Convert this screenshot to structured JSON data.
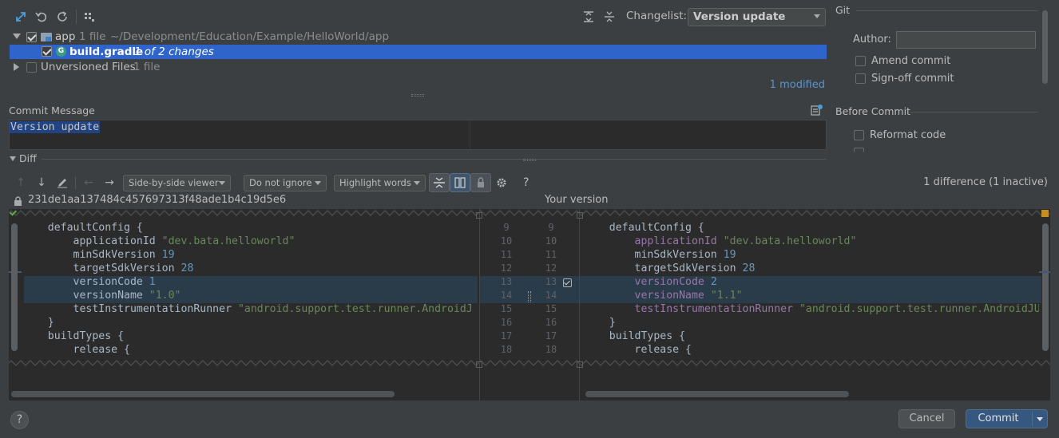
{
  "toolbar": {
    "changelist_label": "Changelist:",
    "changelist_value": "Version update"
  },
  "tree": {
    "root": {
      "name": "app",
      "count": "1 file",
      "path": "~/Development/Education/Example/HelloWorld/app"
    },
    "file": {
      "name": "build.gradle",
      "status": "1 of 2 changes"
    },
    "unversioned": {
      "name": "Unversioned Files",
      "count": "1 file"
    },
    "modified": "1 modified"
  },
  "commit": {
    "label": "Commit Message",
    "message": "Version update"
  },
  "git": {
    "section": "Git",
    "author_label": "Author:",
    "author_value": "",
    "amend": "Amend commit",
    "signoff": "Sign-off commit",
    "before_commit": "Before Commit",
    "reformat": "Reformat code"
  },
  "diff": {
    "label": "Diff",
    "viewer": "Side-by-side viewer",
    "ignore": "Do not ignore",
    "highlight": "Highlight words",
    "help": "?",
    "summary": "1 difference (1 inactive)",
    "left_title": "231de1aa137484c457697313f48ade1b4c19d5e6",
    "right_title": "Your version",
    "line_numbers": [
      "9",
      "10",
      "11",
      "12",
      "13",
      "14",
      "15",
      "16",
      "17",
      "18"
    ],
    "left_lines": [
      [
        {
          "t": "    defaultConfig {",
          "c": "plain"
        }
      ],
      [
        {
          "t": "        applicationId ",
          "c": "plain"
        },
        {
          "t": "\"dev.bata.helloworld\"",
          "c": "kw-str"
        }
      ],
      [
        {
          "t": "        minSdkVersion ",
          "c": "plain"
        },
        {
          "t": "19",
          "c": "kw-num"
        }
      ],
      [
        {
          "t": "        targetSdkVersion ",
          "c": "plain"
        },
        {
          "t": "28",
          "c": "kw-num"
        }
      ],
      [
        {
          "t": "        versionCode ",
          "c": "plain"
        },
        {
          "t": "1",
          "c": "kw-num"
        }
      ],
      [
        {
          "t": "        versionName ",
          "c": "plain"
        },
        {
          "t": "\"1.0\"",
          "c": "kw-str"
        }
      ],
      [
        {
          "t": "        testInstrumentationRunner ",
          "c": "plain"
        },
        {
          "t": "\"android.support.test.runner.AndroidJ",
          "c": "kw-str"
        }
      ],
      [
        {
          "t": "    }",
          "c": "plain"
        }
      ],
      [
        {
          "t": "    buildTypes {",
          "c": "plain"
        }
      ],
      [
        {
          "t": "        release {",
          "c": "plain"
        }
      ]
    ],
    "right_lines": [
      [
        {
          "t": "    defaultConfig {",
          "c": "plain"
        }
      ],
      [
        {
          "t": "        ",
          "c": "plain"
        },
        {
          "t": "applicationId",
          "c": "kw-purple"
        },
        {
          "t": " ",
          "c": "plain"
        },
        {
          "t": "\"dev.bata.helloworld\"",
          "c": "kw-str"
        }
      ],
      [
        {
          "t": "        minSdkVersion ",
          "c": "plain"
        },
        {
          "t": "19",
          "c": "kw-num"
        }
      ],
      [
        {
          "t": "        targetSdkVersion ",
          "c": "plain"
        },
        {
          "t": "28",
          "c": "kw-num"
        }
      ],
      [
        {
          "t": "        ",
          "c": "plain"
        },
        {
          "t": "versionCode",
          "c": "kw-purple"
        },
        {
          "t": " ",
          "c": "plain"
        },
        {
          "t": "2",
          "c": "kw-num"
        }
      ],
      [
        {
          "t": "        ",
          "c": "plain"
        },
        {
          "t": "versionName",
          "c": "kw-purple"
        },
        {
          "t": " ",
          "c": "plain"
        },
        {
          "t": "\"1.1\"",
          "c": "kw-str"
        }
      ],
      [
        {
          "t": "        ",
          "c": "plain"
        },
        {
          "t": "testInstrumentationRunner",
          "c": "kw-purple"
        },
        {
          "t": " ",
          "c": "plain"
        },
        {
          "t": "\"android.support.test.runner.AndroidJUn",
          "c": "kw-str"
        }
      ],
      [
        {
          "t": "    }",
          "c": "plain"
        }
      ],
      [
        {
          "t": "    buildTypes {",
          "c": "plain"
        }
      ],
      [
        {
          "t": "        release {",
          "c": "plain"
        }
      ]
    ]
  },
  "footer": {
    "help": "?",
    "cancel": "Cancel",
    "commit": "Commit"
  },
  "colors": {
    "selection": "#2f65ca",
    "changed_line": "#2a3b4a",
    "background": "#3c3f41",
    "editor": "#2b2b2b"
  }
}
